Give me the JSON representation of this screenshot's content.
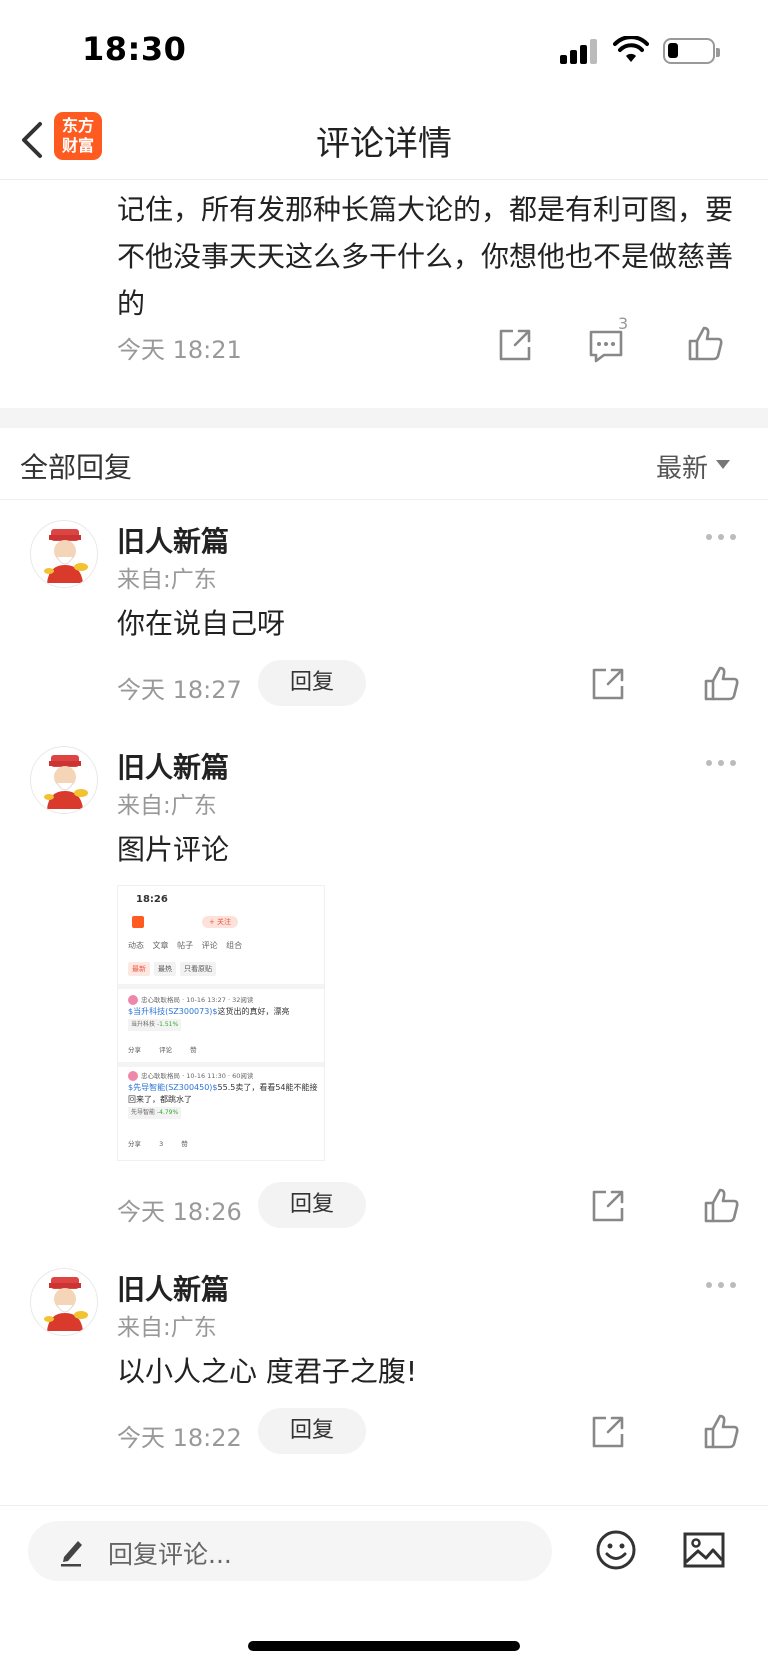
{
  "status_bar": {
    "time": "18:30"
  },
  "header": {
    "title": "评论详情",
    "logo_text": "东方财富"
  },
  "main_comment": {
    "text": "记住，所有发那种长篇大论的，都是有利可图，要不他没事天天这么多干什么，你想他也不是做慈善的",
    "time": "今天 18:21",
    "comment_count": "3"
  },
  "replies_header": {
    "title": "全部回复",
    "sort_label": "最新"
  },
  "replies": [
    {
      "username": "旧人新篇",
      "location": "来自:广东",
      "text": "你在说自己呀",
      "time": "今天 18:27",
      "reply_label": "回复"
    },
    {
      "username": "旧人新篇",
      "location": "来自:广东",
      "text": "图片评论",
      "time": "今天 18:26",
      "reply_label": "回复"
    },
    {
      "username": "旧人新篇",
      "location": "来自:广东",
      "text": "以小人之心 度君子之腹!",
      "time": "今天 18:22",
      "reply_label": "回复"
    }
  ],
  "image_preview": {
    "time": "18:26",
    "follow": "+ 关注",
    "tabs": "动态 文章 帖子 评论 组合",
    "filters": [
      "最新",
      "最热",
      "只看原贴"
    ],
    "posts": [
      {
        "user": "忠心耿耿格局 · 10-16 13:27 · 32阅读",
        "stock": "$当升科技(SZ300073)$",
        "text": "这货出的真好，漂亮",
        "chip_name": "当升科技",
        "chip_value": "-1.51%",
        "actions": "分享 评论 赞"
      },
      {
        "user": "忠心耿耿格局 · 10-16 11:30 · 60阅读",
        "stock": "$先导智能(SZ300450)$",
        "text": "55.5卖了，看看54能不能接回来了，都跳水了",
        "chip_name": "先导智能",
        "chip_value": "-4.79%",
        "actions": "分享 3 赞"
      }
    ]
  },
  "bottom_bar": {
    "placeholder": "回复评论..."
  }
}
